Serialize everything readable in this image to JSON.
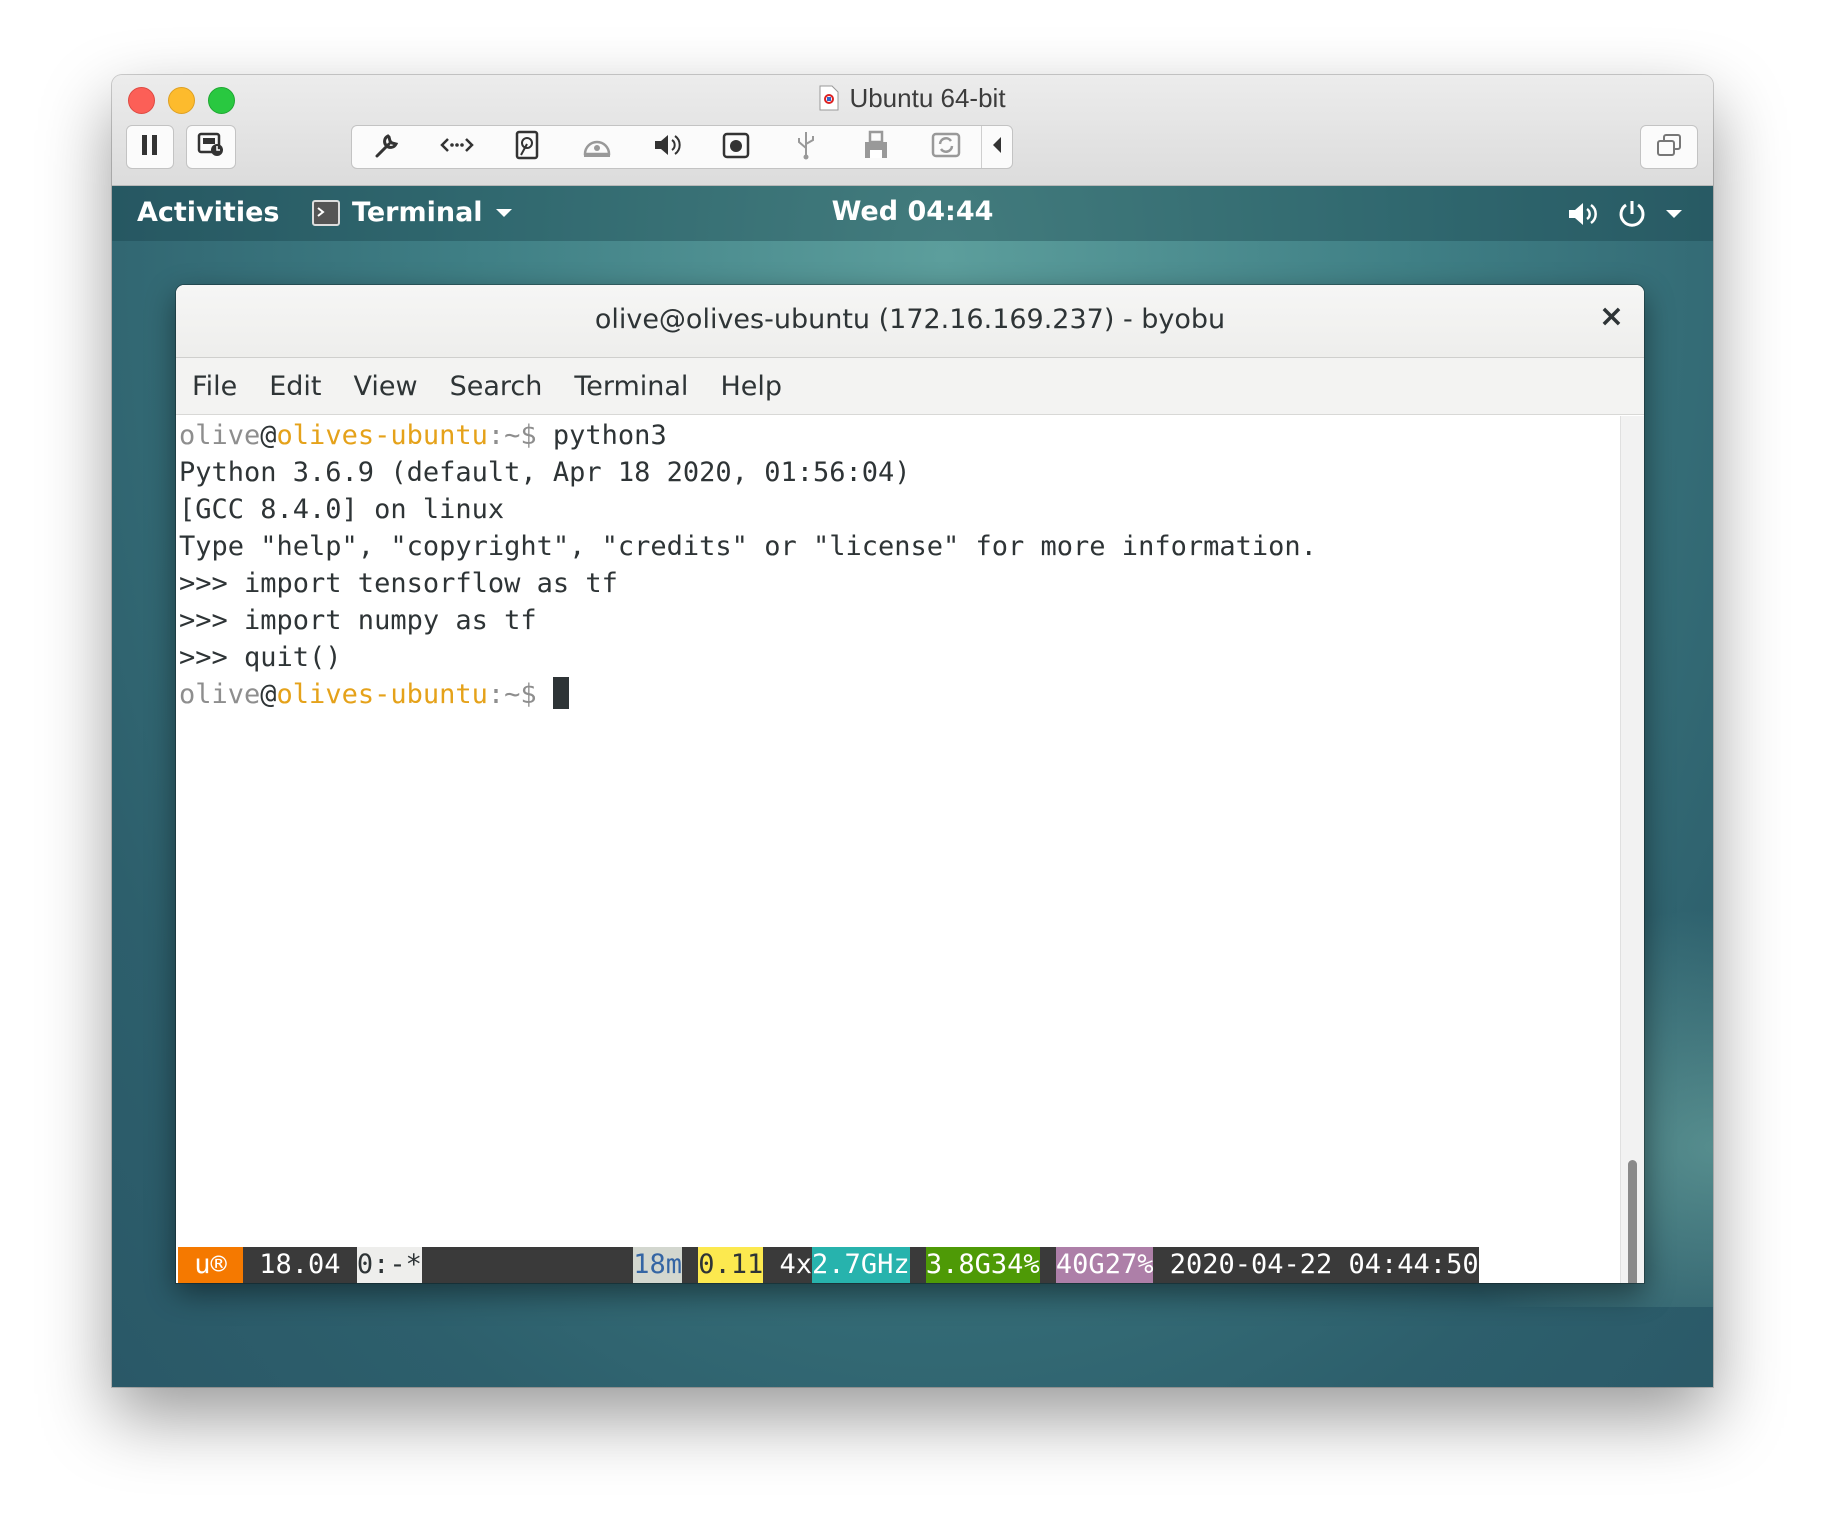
{
  "vm": {
    "title": "Ubuntu 64-bit",
    "toolbar": {
      "pause_icon": "pause-icon",
      "snapshot_icon": "snapshot-icon",
      "tools": [
        "settings-icon",
        "network-icon",
        "hard-disk-icon",
        "cd-icon",
        "sound-icon",
        "camera-icon",
        "usb-icon",
        "printer-icon",
        "sync-icon"
      ],
      "collapse_icon": "chevron-left-icon",
      "window_icon": "window-mode-icon"
    }
  },
  "gnome": {
    "activities": "Activities",
    "app_name": "Terminal",
    "clock": "Wed 04:44"
  },
  "terminal": {
    "title": "olive@olives-ubuntu (172.16.169.237) - byobu",
    "close": "×",
    "menu": [
      "File",
      "Edit",
      "View",
      "Search",
      "Terminal",
      "Help"
    ],
    "prompt": {
      "user": "olive",
      "at": "@",
      "host": "olives-ubuntu",
      "path": ":~$ "
    },
    "lines": [
      {
        "kind": "prompt",
        "cmd": "python3"
      },
      {
        "kind": "out",
        "text": "Python 3.6.9 (default, Apr 18 2020, 01:56:04)"
      },
      {
        "kind": "out",
        "text": "[GCC 8.4.0] on linux"
      },
      {
        "kind": "out",
        "text": "Type \"help\", \"copyright\", \"credits\" or \"license\" for more information."
      },
      {
        "kind": "out",
        "text": ">>> import tensorflow as tf"
      },
      {
        "kind": "out",
        "text": ">>> import numpy as tf"
      },
      {
        "kind": "out",
        "text": ">>> quit()"
      },
      {
        "kind": "prompt",
        "cmd": ""
      }
    ],
    "status": [
      {
        "text": " u® ",
        "bg": "#f57900",
        "fg": "#ffffff"
      },
      {
        "text": " 18.04 ",
        "bg": "#3a3a3a",
        "fg": "#ffffff"
      },
      {
        "text": "0:-*",
        "bg": "#eeeeec",
        "fg": "#2e3436"
      },
      {
        "text": "             ",
        "bg": "#3a3a3a",
        "fg": "#ffffff"
      },
      {
        "text": "18m",
        "bg": "#d3d7cf",
        "fg": "#3465a4"
      },
      {
        "text": " ",
        "bg": "#3a3a3a",
        "fg": "#ffffff"
      },
      {
        "text": "0.11",
        "bg": "#fce94f",
        "fg": "#2e3436"
      },
      {
        "text": " 4x",
        "bg": "#3a3a3a",
        "fg": "#ffffff"
      },
      {
        "text": "2.7GHz",
        "bg": "#27b3ad",
        "fg": "#ffffff"
      },
      {
        "text": " ",
        "bg": "#3a3a3a",
        "fg": "#ffffff"
      },
      {
        "text": "3.8G34%",
        "bg": "#4e9a06",
        "fg": "#ffffff"
      },
      {
        "text": " ",
        "bg": "#3a3a3a",
        "fg": "#ffffff"
      },
      {
        "text": "40G27%",
        "bg": "#ad7fa8",
        "fg": "#ffffff"
      },
      {
        "text": " 2020-04-22 04:44:50",
        "bg": "#3a3a3a",
        "fg": "#ffffff"
      }
    ]
  }
}
